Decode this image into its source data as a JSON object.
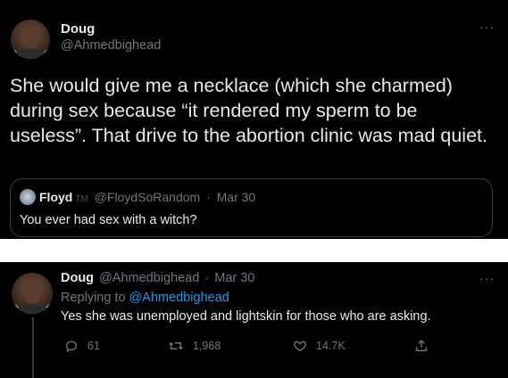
{
  "main_tweet": {
    "author_name": "Doug",
    "author_handle": "@Ahmedbighead",
    "more_glyph": "···",
    "text": "She would give me a necklace (which she charmed) during sex because “it rendered my sperm to be useless”. That drive to the abortion clinic was mad quiet."
  },
  "quoted_tweet": {
    "author_name": "Floyd",
    "badge": "TM",
    "author_handle": "@FloydSoRandom",
    "separator": "·",
    "date": "Mar 30",
    "text": "You ever had sex with a witch?"
  },
  "reply_tweet": {
    "author_name": "Doug",
    "author_handle": "@Ahmedbighead",
    "separator": "·",
    "date": "Mar 30",
    "replying_to_prefix": "Replying to",
    "replying_to_handle": "@Ahmedbighead",
    "text": "Yes she was unemployed and lightskin for those who are asking.",
    "more_glyph": "···",
    "actions": {
      "reply_count": "61",
      "retweet_count": "1,968",
      "like_count": "14.7K"
    }
  },
  "colors": {
    "background": "#000000",
    "text_primary": "#e7e9ea",
    "text_secondary": "#71767b",
    "accent": "#1d9bf0",
    "border": "#3a3d40"
  },
  "icons": [
    "more-icon",
    "reply-icon",
    "retweet-icon",
    "like-icon",
    "share-icon"
  ]
}
